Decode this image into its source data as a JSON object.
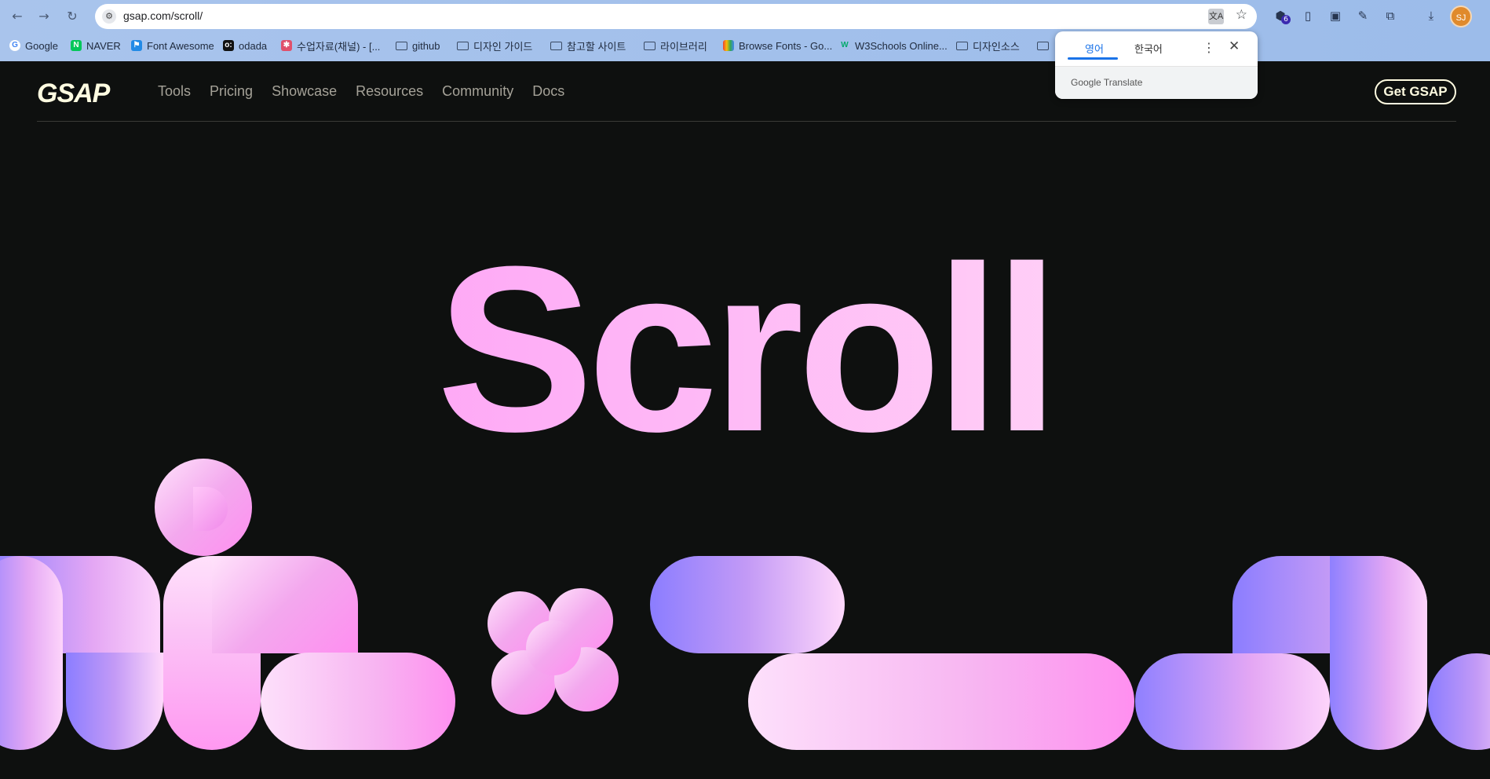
{
  "browser": {
    "url": "gsap.com/scroll/",
    "avatar_initials": "SJ",
    "extension_badge": "6",
    "bookmarks": [
      {
        "label": "Google"
      },
      {
        "label": "NAVER"
      },
      {
        "label": "Font Awesome"
      },
      {
        "label": "odada"
      },
      {
        "label": "수업자료(채널) - [..."
      },
      {
        "label": "github"
      },
      {
        "label": "디자인 가이드"
      },
      {
        "label": "참고할 사이트"
      },
      {
        "label": "라이브러리"
      },
      {
        "label": "Browse Fonts - Go..."
      },
      {
        "label": "W3Schools Online..."
      },
      {
        "label": "디자인소스"
      }
    ]
  },
  "translate_popup": {
    "tab_source": "영어",
    "tab_target": "한국어",
    "brand": "Google Translate"
  },
  "site": {
    "logo": "GSAP",
    "nav": [
      "Tools",
      "Pricing",
      "Showcase",
      "Resources",
      "Community",
      "Docs"
    ],
    "cta": "Get GSAP",
    "hero_title": "Scroll"
  },
  "colors": {
    "page_background": "#0e100f",
    "accent_pink": "#fea1f5",
    "accent_violet": "#8f80ff",
    "cream": "#fffce1"
  }
}
